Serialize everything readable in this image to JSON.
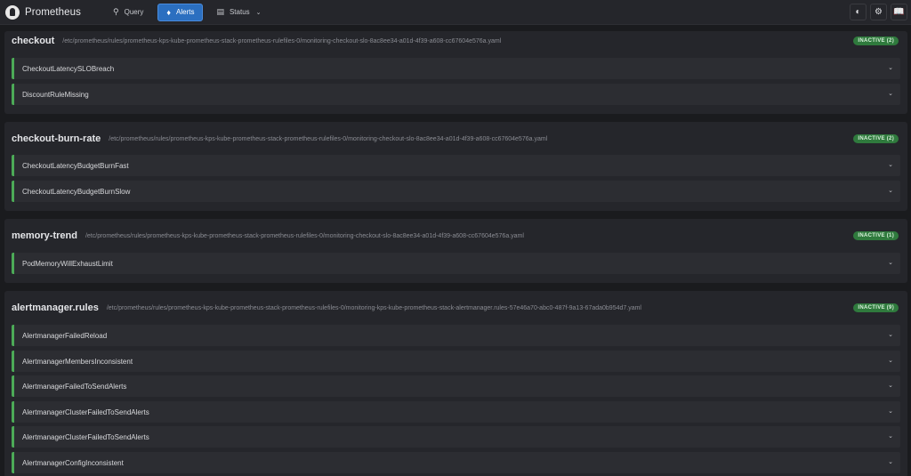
{
  "navbar": {
    "brand": "Prometheus",
    "items": [
      {
        "label": "Query",
        "icon": "search-icon"
      },
      {
        "label": "Alerts",
        "icon": "bell-icon",
        "active": true
      },
      {
        "label": "Status",
        "icon": "server-icon"
      }
    ],
    "right_icons": [
      "theme-toggle-icon",
      "gear-icon",
      "book-icon"
    ],
    "accent_color": "#2b6fc0"
  },
  "groups": [
    {
      "name": "checkout",
      "path": "/etc/prometheus/rules/prometheus-kps-kube-prometheus-stack-prometheus-rulefiles-0/monitoring-checkout-slo-8ac8ee34-a01d-4f39-a608-cc67604e576a.yaml",
      "badge": "INACTIVE (2)",
      "rules": [
        "CheckoutLatencySLOBreach",
        "DiscountRuleMissing"
      ]
    },
    {
      "name": "checkout-burn-rate",
      "path": "/etc/prometheus/rules/prometheus-kps-kube-prometheus-stack-prometheus-rulefiles-0/monitoring-checkout-slo-8ac8ee34-a01d-4f39-a608-cc67604e576a.yaml",
      "badge": "INACTIVE (2)",
      "rules": [
        "CheckoutLatencyBudgetBurnFast",
        "CheckoutLatencyBudgetBurnSlow"
      ]
    },
    {
      "name": "memory-trend",
      "path": "/etc/prometheus/rules/prometheus-kps-kube-prometheus-stack-prometheus-rulefiles-0/monitoring-checkout-slo-8ac8ee34-a01d-4f39-a608-cc67604e576a.yaml",
      "badge": "INACTIVE (1)",
      "rules": [
        "PodMemoryWillExhaustLimit"
      ]
    },
    {
      "name": "alertmanager.rules",
      "path": "/etc/prometheus/rules/prometheus-kps-kube-prometheus-stack-prometheus-rulefiles-0/monitoring-kps-kube-prometheus-stack-alertmanager.rules-57e46a70-abc0-487f-9a13-67ada0b954d7.yaml",
      "badge": "INACTIVE (9)",
      "rules": [
        "AlertmanagerFailedReload",
        "AlertmanagerMembersInconsistent",
        "AlertmanagerFailedToSendAlerts",
        "AlertmanagerClusterFailedToSendAlerts",
        "AlertmanagerClusterFailedToSendAlerts",
        "AlertmanagerConfigInconsistent"
      ]
    }
  ],
  "status_colors": {
    "inactive": "#2f7a3d",
    "rule_border": "#4caa57"
  }
}
